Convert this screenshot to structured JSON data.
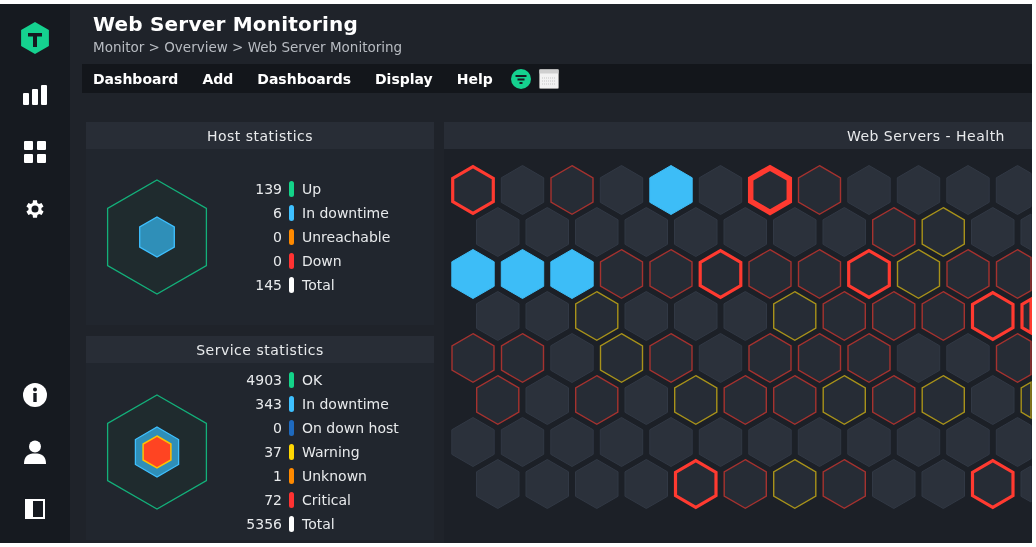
{
  "header": {
    "title": "Web Server Monitoring",
    "breadcrumb": "Monitor > Overview > Web Server Monitoring"
  },
  "menu": [
    "Dashboard",
    "Add",
    "Dashboards",
    "Display",
    "Help"
  ],
  "host_statistics": {
    "title": "Host statistics",
    "rows": [
      {
        "count": "139",
        "label": "Up",
        "color": "#13d389"
      },
      {
        "count": "6",
        "label": "In downtime",
        "color": "#3ec0ff"
      },
      {
        "count": "0",
        "label": "Unreachable",
        "color": "#ff8a00"
      },
      {
        "count": "0",
        "label": "Down",
        "color": "#ff3232"
      },
      {
        "count": "145",
        "label": "Total",
        "color": "#ffffff"
      }
    ]
  },
  "service_statistics": {
    "title": "Service statistics",
    "rows": [
      {
        "count": "4903",
        "label": "OK",
        "color": "#13d389"
      },
      {
        "count": "343",
        "label": "In downtime",
        "color": "#3ec0ff"
      },
      {
        "count": "0",
        "label": "On down host",
        "color": "#1e6abf"
      },
      {
        "count": "37",
        "label": "Warning",
        "color": "#ffd703"
      },
      {
        "count": "1",
        "label": "Unknown",
        "color": "#ff8a00"
      },
      {
        "count": "72",
        "label": "Critical",
        "color": "#ff3232"
      },
      {
        "count": "5356",
        "label": "Total",
        "color": "#ffffff"
      }
    ]
  },
  "health": {
    "title": "Web Servers - Health",
    "rows": [
      [
        {
          "kind": "crit_high"
        },
        {
          "kind": "ok"
        },
        {
          "kind": "crit"
        },
        {
          "kind": "ok"
        },
        {
          "kind": "downtime"
        },
        {
          "kind": "ok"
        },
        {
          "kind": "crit_max"
        },
        {
          "kind": "crit"
        },
        {
          "kind": "ok"
        },
        {
          "kind": "ok"
        },
        {
          "kind": "ok"
        },
        {
          "kind": "ok"
        }
      ],
      [
        {
          "kind": "ok"
        },
        {
          "kind": "ok"
        },
        {
          "kind": "ok"
        },
        {
          "kind": "ok"
        },
        {
          "kind": "ok"
        },
        {
          "kind": "ok"
        },
        {
          "kind": "ok"
        },
        {
          "kind": "ok"
        },
        {
          "kind": "crit"
        },
        {
          "kind": "warn"
        },
        {
          "kind": "ok"
        },
        {
          "kind": "ok"
        }
      ],
      [
        {
          "kind": "downtime"
        },
        {
          "kind": "downtime"
        },
        {
          "kind": "downtime"
        },
        {
          "kind": "crit"
        },
        {
          "kind": "crit"
        },
        {
          "kind": "crit_high"
        },
        {
          "kind": "crit"
        },
        {
          "kind": "crit"
        },
        {
          "kind": "crit_high"
        },
        {
          "kind": "warn"
        },
        {
          "kind": "crit"
        },
        {
          "kind": "crit"
        }
      ],
      [
        {
          "kind": "ok"
        },
        {
          "kind": "ok"
        },
        {
          "kind": "warn"
        },
        {
          "kind": "ok"
        },
        {
          "kind": "ok"
        },
        {
          "kind": "ok"
        },
        {
          "kind": "warn"
        },
        {
          "kind": "crit"
        },
        {
          "kind": "crit"
        },
        {
          "kind": "crit"
        },
        {
          "kind": "crit_high"
        },
        {
          "kind": "crit_high"
        }
      ],
      [
        {
          "kind": "crit"
        },
        {
          "kind": "crit"
        },
        {
          "kind": "ok"
        },
        {
          "kind": "warn"
        },
        {
          "kind": "crit"
        },
        {
          "kind": "ok"
        },
        {
          "kind": "crit"
        },
        {
          "kind": "crit"
        },
        {
          "kind": "crit"
        },
        {
          "kind": "ok"
        },
        {
          "kind": "ok"
        },
        {
          "kind": "crit"
        }
      ],
      [
        {
          "kind": "crit"
        },
        {
          "kind": "ok"
        },
        {
          "kind": "crit"
        },
        {
          "kind": "ok"
        },
        {
          "kind": "warn"
        },
        {
          "kind": "crit"
        },
        {
          "kind": "crit"
        },
        {
          "kind": "warn"
        },
        {
          "kind": "crit"
        },
        {
          "kind": "warn"
        },
        {
          "kind": "ok"
        },
        {
          "kind": "warn"
        }
      ],
      [
        {
          "kind": "ok"
        },
        {
          "kind": "ok"
        },
        {
          "kind": "ok"
        },
        {
          "kind": "ok"
        },
        {
          "kind": "ok"
        },
        {
          "kind": "ok"
        },
        {
          "kind": "ok"
        },
        {
          "kind": "ok"
        },
        {
          "kind": "ok"
        },
        {
          "kind": "ok"
        },
        {
          "kind": "ok"
        },
        {
          "kind": "ok"
        }
      ],
      [
        {
          "kind": "ok"
        },
        {
          "kind": "ok"
        },
        {
          "kind": "ok"
        },
        {
          "kind": "ok"
        },
        {
          "kind": "crit_high"
        },
        {
          "kind": "crit"
        },
        {
          "kind": "warn"
        },
        {
          "kind": "crit"
        },
        {
          "kind": "ok"
        },
        {
          "kind": "ok"
        },
        {
          "kind": "crit_high"
        },
        {
          "kind": "ok"
        }
      ]
    ]
  }
}
